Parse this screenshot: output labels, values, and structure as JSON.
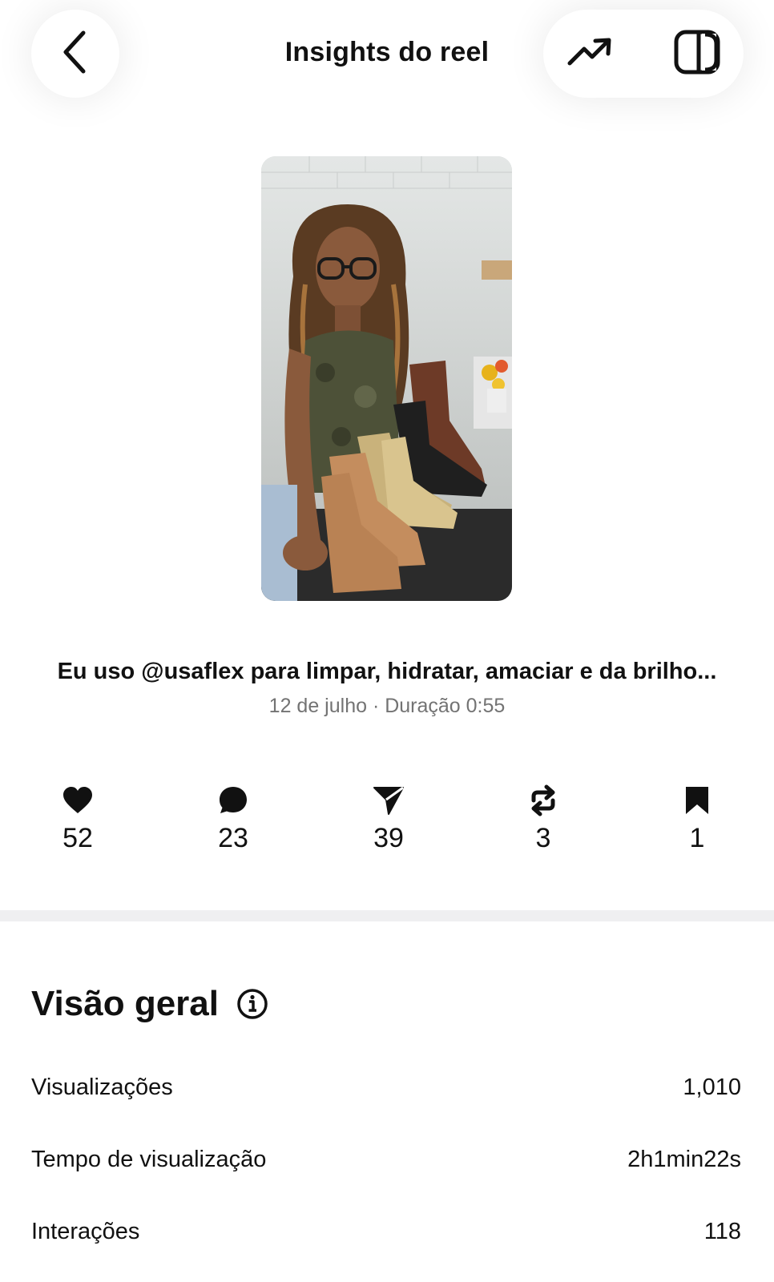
{
  "header": {
    "title": "Insights do reel",
    "back_icon": "chevron-left-icon",
    "trend_icon": "trending-up-icon",
    "panel_icon": "side-panel-icon"
  },
  "reel": {
    "thumbnail_description": "reel-thumbnail",
    "caption": "Eu uso @usaflex para limpar, hidratar, amaciar e da brilho...",
    "meta": "12 de julho · Duração 0:55"
  },
  "stats": [
    {
      "icon": "heart-icon",
      "value": "52"
    },
    {
      "icon": "comment-icon",
      "value": "23"
    },
    {
      "icon": "share-icon",
      "value": "39"
    },
    {
      "icon": "repost-icon",
      "value": "3"
    },
    {
      "icon": "bookmark-icon",
      "value": "1"
    }
  ],
  "overview": {
    "title": "Visão geral",
    "rows": [
      {
        "label": "Visualizações",
        "value": "1,010"
      },
      {
        "label": "Tempo de visualização",
        "value": "2h1min22s"
      },
      {
        "label": "Interações",
        "value": "118"
      }
    ]
  },
  "colors": {
    "text": "#111111",
    "muted": "#737373",
    "divider": "#efeff1"
  }
}
